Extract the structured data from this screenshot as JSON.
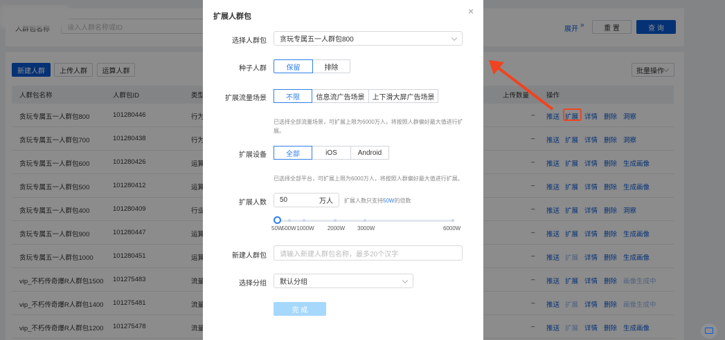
{
  "filter": {
    "label": "人群包名称",
    "search_placeholder": "输入人群名称或ID",
    "expand": "展开",
    "reset": "重 置",
    "query": "查 询"
  },
  "toolbar": {
    "new": "新建人群",
    "upload": "上传人群",
    "compute": "运算人群",
    "batch": "批量操作"
  },
  "table": {
    "headers": {
      "name": "人群包名称",
      "id": "人群包ID",
      "type": "类型",
      "upload": "上传数量",
      "ops": "操作"
    },
    "rows": [
      {
        "name": "贪玩专属五一人群包800",
        "id": "101280446",
        "type": "行为",
        "upload": "–",
        "ops": [
          "推送",
          "扩展",
          "详情",
          "删除",
          "洞察"
        ],
        "expand_disabled": false,
        "last_disabled": false
      },
      {
        "name": "贪玩专属五一人群包700",
        "id": "101280438",
        "type": "行为",
        "upload": "–",
        "ops": [
          "推送",
          "扩展",
          "详情",
          "删除",
          "洞察"
        ],
        "expand_disabled": false,
        "last_disabled": false
      },
      {
        "name": "贪玩专属五一人群包600",
        "id": "101280426",
        "type": "运算",
        "upload": "–",
        "ops": [
          "推送",
          "扩展",
          "详情",
          "删除",
          "生成画像"
        ],
        "expand_disabled": false,
        "last_disabled": false
      },
      {
        "name": "贪玩专属五一人群包500",
        "id": "101280412",
        "type": "运算",
        "upload": "–",
        "ops": [
          "推送",
          "扩展",
          "详情",
          "删除",
          "生成画像"
        ],
        "expand_disabled": false,
        "last_disabled": false
      },
      {
        "name": "贪玩专属五一人群包400",
        "id": "101280409",
        "type": "行业",
        "upload": "–",
        "ops": [
          "推送",
          "扩展",
          "详情",
          "删除",
          "洞察"
        ],
        "expand_disabled": false,
        "last_disabled": false
      },
      {
        "name": "贪玩专属五一人群包900",
        "id": "101280447",
        "type": "运算",
        "upload": "–",
        "ops": [
          "推送",
          "扩展",
          "详情",
          "删除",
          "生成画像"
        ],
        "expand_disabled": false,
        "last_disabled": false
      },
      {
        "name": "贪玩专属五一人群包1000",
        "id": "101280451",
        "type": "运算",
        "upload": "–",
        "ops": [
          "推送",
          "扩展",
          "详情",
          "删除",
          "生成画像"
        ],
        "expand_disabled": true,
        "last_disabled": false
      },
      {
        "name": "vip_不朽传奇爆R人群包1500",
        "id": "101275483",
        "type": "流量",
        "upload": "–",
        "ops": [
          "推送",
          "扩展",
          "详情",
          "删除",
          "画像生成中"
        ],
        "expand_disabled": false,
        "last_disabled": true
      },
      {
        "name": "vip_不朽传奇爆R人群包1400",
        "id": "101275481",
        "type": "流量",
        "upload": "–",
        "ops": [
          "推送",
          "扩展",
          "详情",
          "删除",
          "画像生成中"
        ],
        "expand_disabled": true,
        "last_disabled": true
      },
      {
        "name": "vip_不朽传奇爆R人群包1200",
        "id": "101275478",
        "type": "流量",
        "upload": "–",
        "ops": [
          "推送",
          "扩展",
          "详情",
          "删除",
          "生成画像"
        ],
        "expand_disabled": true,
        "last_disabled": false
      }
    ]
  },
  "modal": {
    "title": "扩展人群包",
    "select_pack_label": "选择人群包",
    "select_pack_value": "贪玩专属五一人群包800",
    "seed_label": "种子人群",
    "seed_options": [
      "保留",
      "排除"
    ],
    "seed_selected": 0,
    "scene_label": "扩展流量场景",
    "scene_options": [
      "不限",
      "信息流广告场景",
      "上下滑大屏广告场景"
    ],
    "scene_selected": 0,
    "scene_hint": "已选择全部流量场景，可扩展上限为6000万人，将按照人群偏好最大值进行扩展。",
    "device_label": "扩展设备",
    "device_options": [
      "全部",
      "iOS",
      "Android"
    ],
    "device_selected": 0,
    "device_hint": "已选择全部平台，可扩展上限为6000万人，将按照人群偏好最大值进行扩展。",
    "count_label": "扩展人数",
    "count_value": "50",
    "count_unit": "万人",
    "count_hint_pre": "扩展人数只支持",
    "count_hint_em": "50W",
    "count_hint_post": "的倍数",
    "slider": {
      "min": 50,
      "max": 6000,
      "value": 50,
      "marks": [
        {
          "v": 50,
          "label": "50W"
        },
        {
          "v": 500,
          "label": "500W"
        },
        {
          "v": 1000,
          "label": "1000W"
        },
        {
          "v": 2000,
          "label": "2000W"
        },
        {
          "v": 3000,
          "label": "3000W"
        },
        {
          "v": 6000,
          "label": "6000W"
        }
      ]
    },
    "new_pack_label": "新建人群包",
    "new_pack_placeholder": "请输入新建人群包名称，最多20个汉字",
    "group_label": "选择分组",
    "group_value": "默认分组",
    "submit": "完 成"
  },
  "colors": {
    "primary": "#0a5ad6",
    "accent": "#2f7fe8",
    "annotation": "#f0431f"
  }
}
